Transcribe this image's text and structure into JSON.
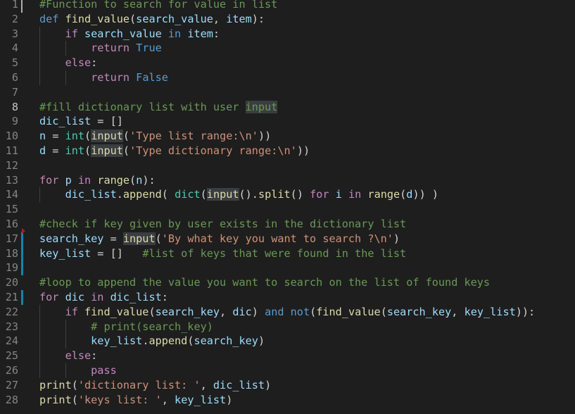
{
  "editor": {
    "line_numbers": [
      "1",
      "2",
      "3",
      "4",
      "5",
      "6",
      "7",
      "8",
      "9",
      "10",
      "11",
      "12",
      "13",
      "14",
      "15",
      "16",
      "17",
      "18",
      "19",
      "20",
      "21",
      "22",
      "23",
      "24",
      "25",
      "26",
      "27",
      "28"
    ],
    "lines": [
      [
        {
          "t": "#Function to search for value in list",
          "c": "com"
        }
      ],
      [
        {
          "t": "def ",
          "c": "kw"
        },
        {
          "t": "find_value",
          "c": "fn"
        },
        {
          "t": "(",
          "c": "plain"
        },
        {
          "t": "search_value",
          "c": "var"
        },
        {
          "t": ", ",
          "c": "plain"
        },
        {
          "t": "item",
          "c": "var"
        },
        {
          "t": "):",
          "c": "plain"
        }
      ],
      [
        {
          "t": "    ",
          "c": "plain"
        },
        {
          "t": "if ",
          "c": "kw2"
        },
        {
          "t": "search_value ",
          "c": "var"
        },
        {
          "t": "in ",
          "c": "kwblue"
        },
        {
          "t": "item",
          "c": "var"
        },
        {
          "t": ":",
          "c": "plain"
        }
      ],
      [
        {
          "t": "        ",
          "c": "plain"
        },
        {
          "t": "return ",
          "c": "kw2"
        },
        {
          "t": "True",
          "c": "kwblue"
        }
      ],
      [
        {
          "t": "    ",
          "c": "plain"
        },
        {
          "t": "else",
          "c": "kw2"
        },
        {
          "t": ":",
          "c": "plain"
        }
      ],
      [
        {
          "t": "        ",
          "c": "plain"
        },
        {
          "t": "return ",
          "c": "kw2"
        },
        {
          "t": "False",
          "c": "kwblue"
        }
      ],
      [],
      [
        {
          "t": "#fill dictionary list with user ",
          "c": "com"
        },
        {
          "t": "input",
          "c": "com",
          "h": true
        }
      ],
      [
        {
          "t": "dic_list",
          "c": "var"
        },
        {
          "t": " = []",
          "c": "plain"
        }
      ],
      [
        {
          "t": "n",
          "c": "var"
        },
        {
          "t": " = ",
          "c": "plain"
        },
        {
          "t": "int",
          "c": "builtin"
        },
        {
          "t": "(",
          "c": "plain"
        },
        {
          "t": "input",
          "c": "fn",
          "h": true
        },
        {
          "t": "(",
          "c": "plain"
        },
        {
          "t": "'Type list range:\\n'",
          "c": "str"
        },
        {
          "t": "))",
          "c": "plain"
        }
      ],
      [
        {
          "t": "d",
          "c": "var"
        },
        {
          "t": " = ",
          "c": "plain"
        },
        {
          "t": "int",
          "c": "builtin"
        },
        {
          "t": "(",
          "c": "plain"
        },
        {
          "t": "input",
          "c": "fn",
          "h": true
        },
        {
          "t": "(",
          "c": "plain"
        },
        {
          "t": "'Type dictionary range:\\n'",
          "c": "str"
        },
        {
          "t": "))",
          "c": "plain"
        }
      ],
      [],
      [
        {
          "t": "for ",
          "c": "kw2"
        },
        {
          "t": "p ",
          "c": "var"
        },
        {
          "t": "in ",
          "c": "kw2"
        },
        {
          "t": "range",
          "c": "fn"
        },
        {
          "t": "(",
          "c": "plain"
        },
        {
          "t": "n",
          "c": "var"
        },
        {
          "t": "):",
          "c": "plain"
        }
      ],
      [
        {
          "t": "    ",
          "c": "plain"
        },
        {
          "t": "dic_list",
          "c": "var"
        },
        {
          "t": ".",
          "c": "plain"
        },
        {
          "t": "append",
          "c": "fn"
        },
        {
          "t": "( ",
          "c": "plain"
        },
        {
          "t": "dict",
          "c": "builtin"
        },
        {
          "t": "(",
          "c": "plain"
        },
        {
          "t": "input",
          "c": "fn",
          "h": true
        },
        {
          "t": "().",
          "c": "plain"
        },
        {
          "t": "split",
          "c": "fn"
        },
        {
          "t": "() ",
          "c": "plain"
        },
        {
          "t": "for ",
          "c": "kw2"
        },
        {
          "t": "i ",
          "c": "var"
        },
        {
          "t": "in ",
          "c": "kw2"
        },
        {
          "t": "range",
          "c": "fn"
        },
        {
          "t": "(",
          "c": "plain"
        },
        {
          "t": "d",
          "c": "var"
        },
        {
          "t": ")) )",
          "c": "plain"
        }
      ],
      [],
      [
        {
          "t": "#check if key given by user exists in the dictionary list",
          "c": "com"
        }
      ],
      [
        {
          "t": "search_key",
          "c": "var"
        },
        {
          "t": " = ",
          "c": "plain"
        },
        {
          "t": "input",
          "c": "fn",
          "h": true
        },
        {
          "t": "(",
          "c": "plain"
        },
        {
          "t": "'By what key you want to search ?\\n'",
          "c": "str"
        },
        {
          "t": ")",
          "c": "plain"
        }
      ],
      [
        {
          "t": "key_list",
          "c": "var"
        },
        {
          "t": " = []   ",
          "c": "plain"
        },
        {
          "t": "#list of keys that were found in the list",
          "c": "com"
        }
      ],
      [],
      [
        {
          "t": "#loop to append the value you want to search on the list of found keys",
          "c": "com"
        }
      ],
      [
        {
          "t": "for ",
          "c": "kw2"
        },
        {
          "t": "dic ",
          "c": "var"
        },
        {
          "t": "in ",
          "c": "kw2"
        },
        {
          "t": "dic_list",
          "c": "var"
        },
        {
          "t": ":",
          "c": "plain"
        }
      ],
      [
        {
          "t": "    ",
          "c": "plain"
        },
        {
          "t": "if ",
          "c": "kw2"
        },
        {
          "t": "find_value",
          "c": "fn"
        },
        {
          "t": "(",
          "c": "plain"
        },
        {
          "t": "search_key",
          "c": "var"
        },
        {
          "t": ", ",
          "c": "plain"
        },
        {
          "t": "dic",
          "c": "var"
        },
        {
          "t": ") ",
          "c": "plain"
        },
        {
          "t": "and ",
          "c": "kwblue"
        },
        {
          "t": "not",
          "c": "kwblue"
        },
        {
          "t": "(",
          "c": "plain"
        },
        {
          "t": "find_value",
          "c": "fn"
        },
        {
          "t": "(",
          "c": "plain"
        },
        {
          "t": "search_key",
          "c": "var"
        },
        {
          "t": ", ",
          "c": "plain"
        },
        {
          "t": "key_list",
          "c": "var"
        },
        {
          "t": ")):",
          "c": "plain"
        }
      ],
      [
        {
          "t": "        ",
          "c": "plain"
        },
        {
          "t": "# print(search_key)",
          "c": "com"
        }
      ],
      [
        {
          "t": "        ",
          "c": "plain"
        },
        {
          "t": "key_list",
          "c": "var"
        },
        {
          "t": ".",
          "c": "plain"
        },
        {
          "t": "append",
          "c": "fn"
        },
        {
          "t": "(",
          "c": "plain"
        },
        {
          "t": "search_key",
          "c": "var"
        },
        {
          "t": ")",
          "c": "plain"
        }
      ],
      [
        {
          "t": "    ",
          "c": "plain"
        },
        {
          "t": "else",
          "c": "kw2"
        },
        {
          "t": ":",
          "c": "plain"
        }
      ],
      [
        {
          "t": "        ",
          "c": "plain"
        },
        {
          "t": "pass",
          "c": "kw2"
        }
      ],
      [
        {
          "t": "print",
          "c": "fn"
        },
        {
          "t": "(",
          "c": "plain"
        },
        {
          "t": "'dictionary list: '",
          "c": "str"
        },
        {
          "t": ", ",
          "c": "plain"
        },
        {
          "t": "dic_list",
          "c": "var"
        },
        {
          "t": ")",
          "c": "plain"
        }
      ],
      [
        {
          "t": "print",
          "c": "fn"
        },
        {
          "t": "(",
          "c": "plain"
        },
        {
          "t": "'keys list: '",
          "c": "str"
        },
        {
          "t": ", ",
          "c": "plain"
        },
        {
          "t": "key_list",
          "c": "var"
        },
        {
          "t": ")",
          "c": "plain"
        }
      ]
    ]
  }
}
